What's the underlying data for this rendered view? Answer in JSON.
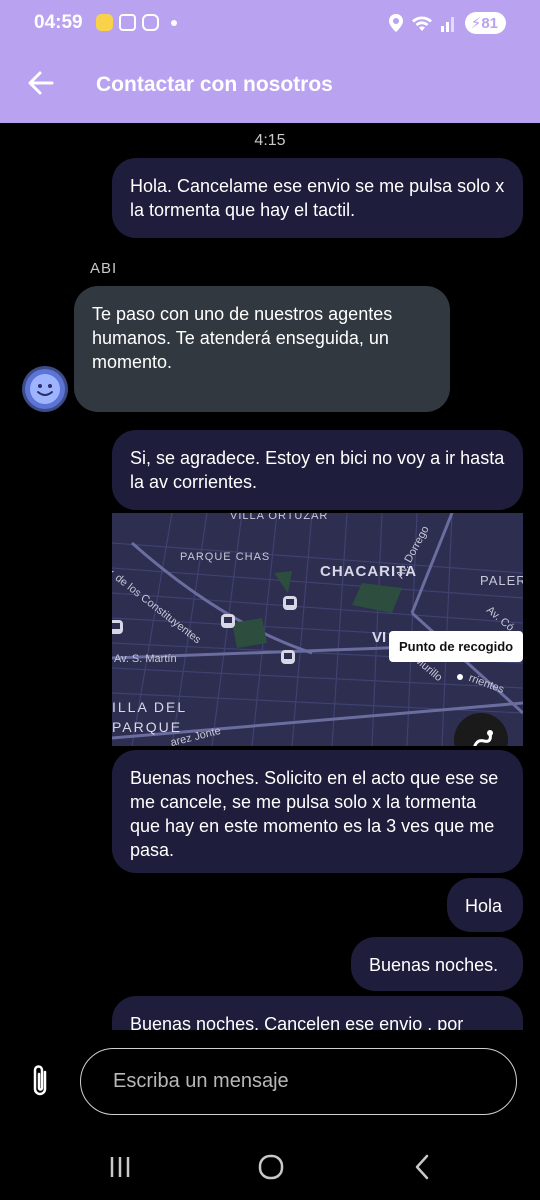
{
  "status_bar": {
    "time": "04:59",
    "battery": "81"
  },
  "app_bar": {
    "title": "Contactar con nosotros"
  },
  "chat": {
    "timestamp": "4:15",
    "messages": [
      {
        "text": "Hola. Cancelame ese envio se me pulsa solo x la tormenta que hay el tactil."
      },
      {
        "sender": "ABI",
        "text": "Te paso con uno de nuestros agentes humanos. Te atenderá enseguida, un momento."
      },
      {
        "text": "Si, se agradece. Estoy en bici no voy a ir hasta la av corrientes."
      },
      {
        "text": "Buenas noches. Solicito en el acto que ese se me cancele, se me pulsa solo x la tormenta que hay en este momento es la 3 ves que me pasa."
      },
      {
        "text": "Hola"
      },
      {
        "text": "Buenas noches."
      },
      {
        "text": "Buenas noches. Cancelen ese envio . por"
      }
    ],
    "map": {
      "labels": [
        "VILLA ORTUZAR",
        "PARQUE CHAS",
        "CHACARITA",
        "PALER",
        "Av. de los Constituyentes",
        "Av. Dorrego",
        "Av. Có",
        "Av. S. Martín",
        "VI",
        "Murillo",
        "rrientes",
        "ILLA DEL",
        "PARQUE",
        "arez Jonte"
      ],
      "pickup_label": "Punto de recogido"
    }
  },
  "composer": {
    "placeholder": "Escriba un mensaje"
  },
  "icons": {
    "back": "arrow-left-icon",
    "attach": "paperclip-icon",
    "avatar": "smiley-bot-icon",
    "route": "route-icon",
    "nav_recent": "recent-apps-icon",
    "nav_home": "home-icon",
    "nav_back": "chevron-left-icon"
  },
  "colors": {
    "header": "#b9a2f0",
    "outgoing_bubble": "#1e1d3b",
    "incoming_bubble": "#32383f",
    "background": "#000000"
  }
}
